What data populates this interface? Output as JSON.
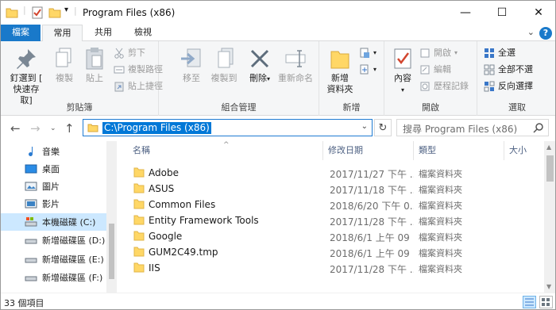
{
  "window": {
    "title": "Program Files (x86)",
    "controls": {
      "minimize": "—",
      "maximize": "☐",
      "close": "✕"
    }
  },
  "tabs": {
    "file": "檔案",
    "home": "常用",
    "share": "共用",
    "view": "檢視"
  },
  "ribbon": {
    "clipboard": {
      "label": "剪貼簿",
      "pin_line1": "釘選到 [",
      "pin_line2": "快速存取]",
      "copy": "複製",
      "paste": "貼上",
      "cut": "剪下",
      "copy_path": "複製路徑",
      "paste_shortcut": "貼上捷徑"
    },
    "organize": {
      "label": "組合管理",
      "move_to": "移至",
      "copy_to": "複製到",
      "delete": "刪除",
      "rename": "重新命名"
    },
    "new": {
      "label": "新增",
      "new_folder_line1": "新增",
      "new_folder_line2": "資料夾"
    },
    "open": {
      "label": "開啟",
      "properties": "內容",
      "open": "開啟",
      "edit": "編輯",
      "history": "歷程記錄"
    },
    "select": {
      "label": "選取",
      "select_all": "全選",
      "select_none": "全部不選",
      "invert": "反向選擇"
    }
  },
  "address": {
    "path": "C:\\Program Files (x86)",
    "search_placeholder": "搜尋 Program Files (x86)"
  },
  "nav_pane": {
    "items": [
      {
        "label": "音樂",
        "icon": "music-icon"
      },
      {
        "label": "桌面",
        "icon": "desktop-icon"
      },
      {
        "label": "圖片",
        "icon": "pictures-icon"
      },
      {
        "label": "影片",
        "icon": "videos-icon"
      },
      {
        "label": "本機磁碟 (C:)",
        "icon": "drive-icon",
        "selected": true
      },
      {
        "label": "新增磁碟區 (D:)",
        "icon": "drive-icon"
      },
      {
        "label": "新增磁碟區 (E:)",
        "icon": "drive-icon"
      },
      {
        "label": "新增磁碟區 (F:)",
        "icon": "drive-icon"
      }
    ]
  },
  "file_list": {
    "columns": [
      "名稱",
      "修改日期",
      "類型",
      "大小"
    ],
    "rows": [
      {
        "name": "Adobe",
        "date": "2017/11/27 下午 ...",
        "type": "檔案資料夾"
      },
      {
        "name": "ASUS",
        "date": "2017/11/18 下午 ...",
        "type": "檔案資料夾"
      },
      {
        "name": "Common Files",
        "date": "2018/6/20 下午 0...",
        "type": "檔案資料夾"
      },
      {
        "name": "Entity Framework Tools",
        "date": "2017/11/28 下午 ...",
        "type": "檔案資料夾"
      },
      {
        "name": "Google",
        "date": "2018/6/1 上午 09",
        "type": "檔案資料夾"
      },
      {
        "name": "GUM2C49.tmp",
        "date": "2018/6/1 上午 09",
        "type": "檔案資料夾"
      },
      {
        "name": "IIS",
        "date": "2017/11/28 下午 ...",
        "type": "檔案資料夾"
      }
    ]
  },
  "status": {
    "item_count": "33 個項目"
  },
  "colors": {
    "accent": "#1979ca",
    "selection": "#cce8ff",
    "folder": "#ffd766"
  }
}
